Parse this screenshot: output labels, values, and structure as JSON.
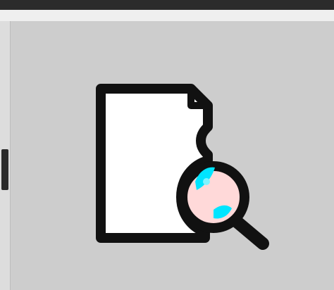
{
  "toolbar": {
    "buttons": [
      {
        "icon": "document-preview-icon",
        "state": "hover"
      }
    ]
  },
  "colors": {
    "top_rule": "#2b2b2b",
    "button_background": "#cdcdcd",
    "icon_outline": "#111111",
    "document_fill": "#ffffff",
    "lens_tint": "#ffd9d9",
    "lens_highlight": "#00e5ff"
  }
}
